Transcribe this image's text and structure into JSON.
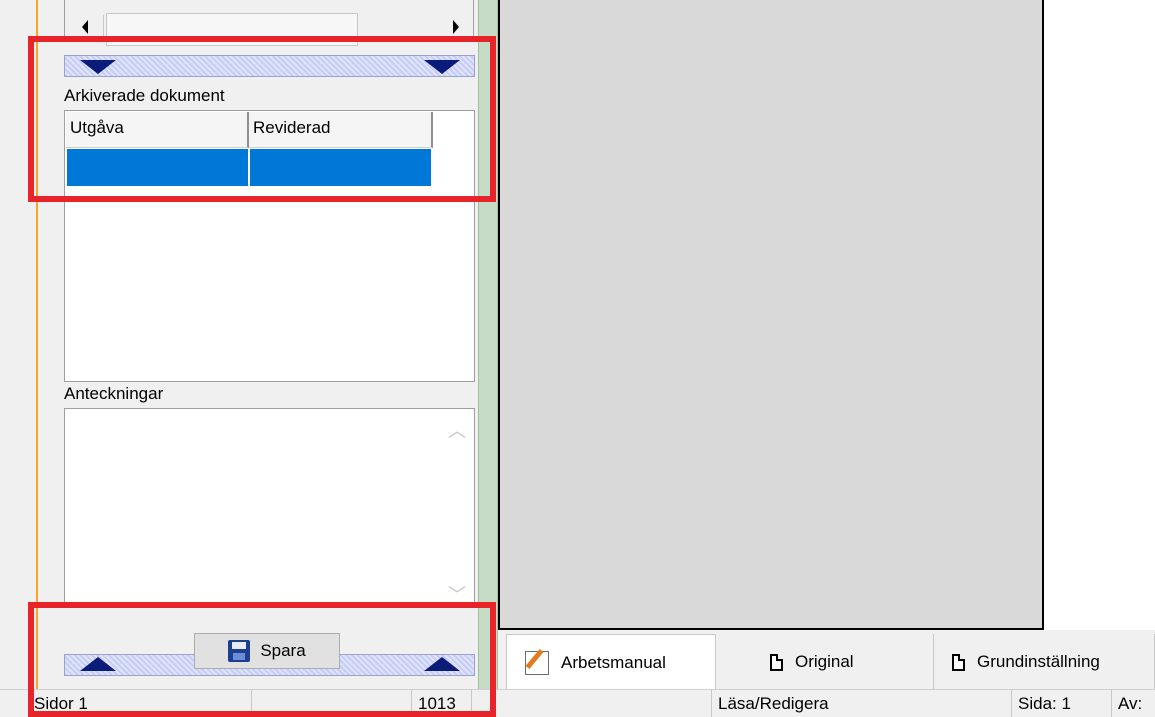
{
  "archived": {
    "label": "Arkiverade dokument",
    "columns": [
      "Utgåva",
      "Reviderad"
    ]
  },
  "notes": {
    "label": "Anteckningar",
    "value": ""
  },
  "save_button": {
    "label": "Spara"
  },
  "tabs": [
    {
      "label": "Arbetsmanual",
      "icon": "edit-page-icon",
      "active": true
    },
    {
      "label": "Original",
      "icon": "page-icon",
      "active": false
    },
    {
      "label": "Grundinställning",
      "icon": "page-icon",
      "active": false
    }
  ],
  "statusbar": {
    "pages": "Sidor 1",
    "number": "1013",
    "mode": "Läsa/Redigera",
    "page": "Sida: 1",
    "of": "Av:"
  },
  "colors": {
    "highlight": "#e8242b",
    "selection": "#0078d7",
    "splitter_arrow": "#0b1b7a"
  }
}
